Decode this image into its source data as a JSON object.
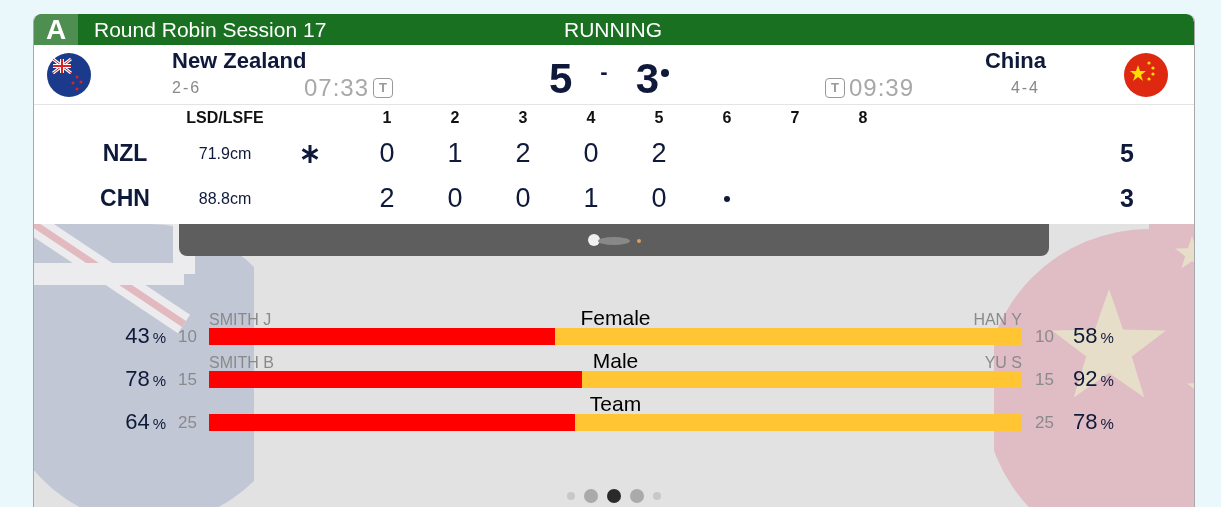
{
  "header": {
    "sheet": "A",
    "title": "Round Robin Session 17",
    "status": "RUNNING"
  },
  "teams": [
    {
      "name": "New Zealand",
      "record": "2-6",
      "time": "07:33",
      "timeout_label": "T",
      "score": "5",
      "hammer": false
    },
    {
      "name": "China",
      "record": "4-4",
      "time": "09:39",
      "timeout_label": "T",
      "score": "3",
      "hammer": true
    }
  ],
  "score_separator": "-",
  "linescore": {
    "lsd_heading": "LSD/LSFE",
    "ends": [
      "1",
      "2",
      "3",
      "4",
      "5",
      "6",
      "7",
      "8"
    ],
    "rows": [
      {
        "code": "NZL",
        "lsd": "71.9cm",
        "first_hammer": true,
        "scores": [
          "0",
          "1",
          "2",
          "0",
          "2"
        ],
        "playing": false,
        "total": "5"
      },
      {
        "code": "CHN",
        "lsd": "88.8cm",
        "first_hammer": false,
        "scores": [
          "2",
          "0",
          "0",
          "1",
          "0"
        ],
        "playing": true,
        "total": "3"
      }
    ]
  },
  "stats": [
    {
      "category": "Female",
      "left_player": "SMITH J",
      "right_player": "HAN Y",
      "left_count": "10",
      "right_count": "10",
      "left_pct": "43",
      "left_unit": "%",
      "right_pct": "58",
      "right_unit": "%",
      "level": 0.426
    },
    {
      "category": "Male",
      "left_player": "SMITH B",
      "right_player": "YU S",
      "left_count": "15",
      "right_count": "15",
      "left_pct": "78",
      "left_unit": "%",
      "right_pct": "92",
      "right_unit": "%",
      "level": 0.459
    },
    {
      "category": "Team",
      "left_count": "25",
      "right_count": "25",
      "left_pct": "64",
      "left_unit": "%",
      "right_pct": "78",
      "right_unit": "%",
      "level": 0.45
    }
  ],
  "pager": [
    {
      "selected": false
    },
    {
      "selected": false
    },
    {
      "selected": true
    },
    {
      "selected": false
    },
    {
      "selected": false
    }
  ]
}
